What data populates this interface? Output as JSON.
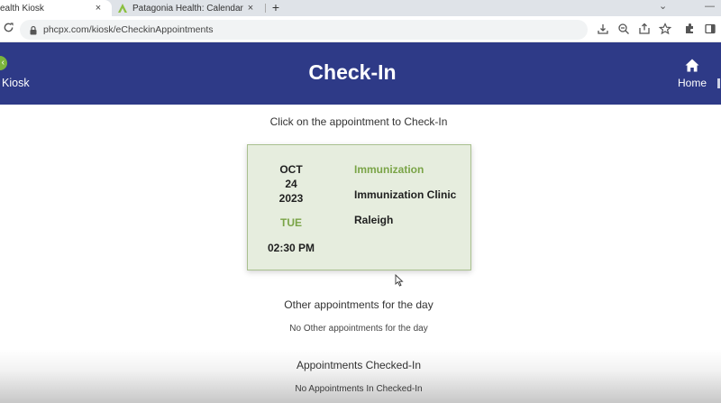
{
  "browser": {
    "tabs": [
      {
        "title": "ealth Kiosk",
        "active": true
      },
      {
        "title": "Patagonia Health: Calendar",
        "active": false
      }
    ],
    "close_glyph": "×",
    "new_tab_glyph": "+",
    "window_controls": [
      "⌄",
      "—"
    ],
    "url": "phcpx.com/kiosk/eCheckinAppointments",
    "toolbar_icons": [
      "download-icon",
      "zoom-icon",
      "share-icon",
      "star-icon",
      "extensions-icon",
      "sidepanel-icon"
    ]
  },
  "header": {
    "back_label": "Kiosk",
    "title": "Check-In",
    "home_label": "Home",
    "bg_color": "#2e3a87",
    "accent_color": "#7bb53c"
  },
  "main": {
    "instruction": "Click on the appointment to Check-In",
    "appointment": {
      "month": "OCT",
      "day": "24",
      "year": "2023",
      "weekday": "TUE",
      "time": "02:30 PM",
      "type": "Immunization",
      "clinic": "Immunization Clinic",
      "location": "Raleigh"
    },
    "other_heading": "Other appointments for the day",
    "other_empty": "No Other appointments for the day",
    "checked_heading": "Appointments Checked-In",
    "checked_empty": "No Appointments In Checked-In"
  }
}
